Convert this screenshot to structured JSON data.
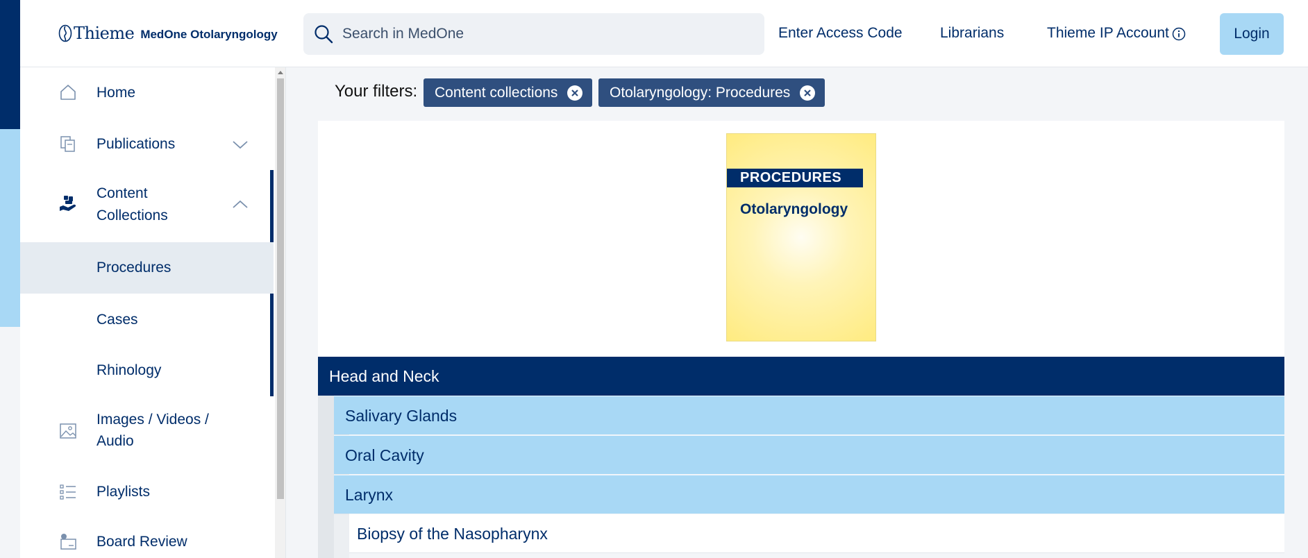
{
  "header": {
    "brand": "Thieme",
    "product": "MedOne Otolaryngology",
    "search_placeholder": "Search in MedOne",
    "links": [
      "Enter Access Code",
      "Librarians",
      "Thieme IP Account"
    ],
    "login_label": "Login"
  },
  "sidebar": {
    "home": "Home",
    "publications": "Publications",
    "content_collections_line1": "Content",
    "content_collections_line2": "Collections",
    "sub_items": [
      "Procedures",
      "Cases",
      "Rhinology"
    ],
    "images_line1": "Images / Videos /",
    "images_line2": "Audio",
    "playlists": "Playlists",
    "board_review": "Board Review"
  },
  "filters": {
    "label": "Your filters:",
    "chips": [
      "Content collections",
      "Otolaryngology: Procedures"
    ]
  },
  "cover": {
    "band": "PROCEDURES",
    "title": "Otolaryngology"
  },
  "tree": {
    "head": "Head and Neck",
    "subs": [
      "Salivary Glands",
      "Oral Cavity",
      "Larynx"
    ],
    "leaf": "Biopsy of the Nasopharynx"
  },
  "colors": {
    "navy": "#002d6a",
    "light_blue": "#a8d8f5",
    "chip": "#2f4f7f"
  }
}
